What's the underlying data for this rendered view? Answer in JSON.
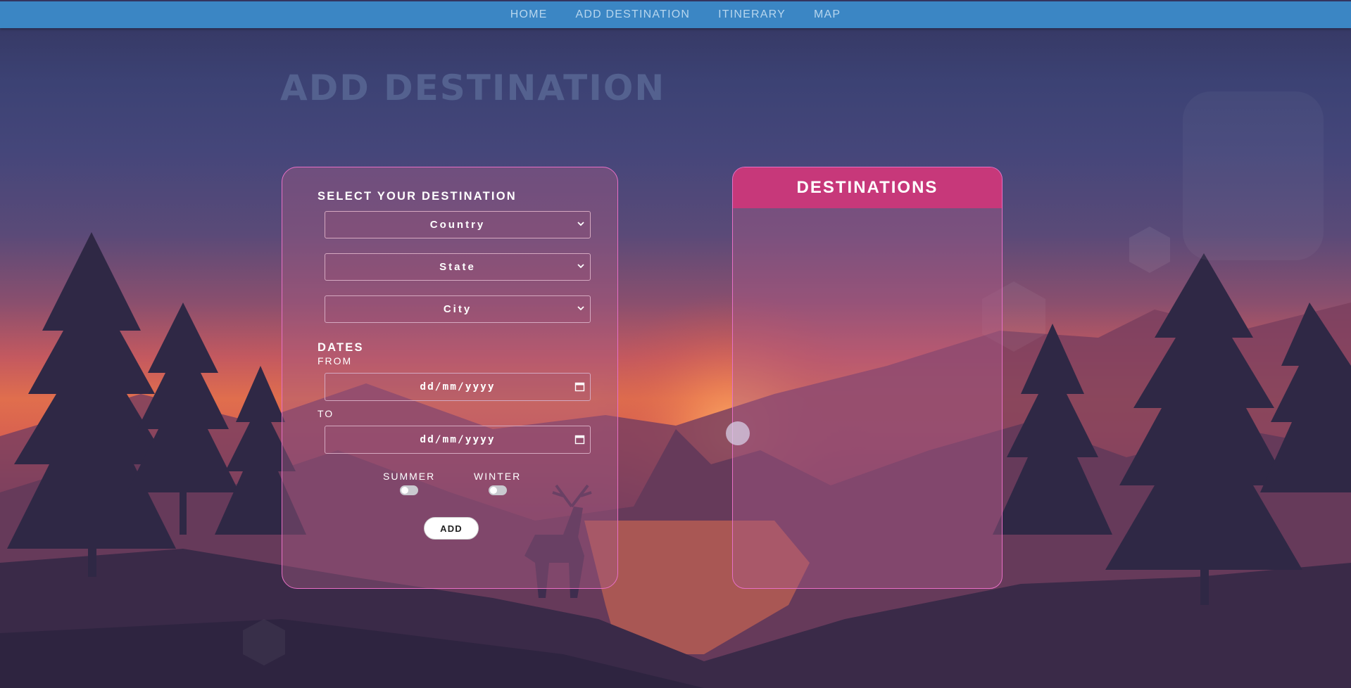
{
  "nav": {
    "items": [
      "HOME",
      "ADD DESTINATION",
      "ITINERARY",
      "MAP"
    ]
  },
  "page_title": "ADD DESTINATION",
  "form": {
    "heading": "SELECT YOUR DESTINATION",
    "country_select": {
      "value": "Country",
      "icon": "chevron-down-icon"
    },
    "state_select": {
      "value": "State",
      "icon": "chevron-down-icon"
    },
    "city_select": {
      "value": "City",
      "icon": "chevron-down-icon"
    },
    "dates_heading": "DATES",
    "from_label": "FROM",
    "from_placeholder": "dd/mm/yyyy",
    "to_label": "TO",
    "to_placeholder": "dd/mm/yyyy",
    "summer_label": "SUMMER",
    "summer_on": false,
    "winter_label": "WINTER",
    "winter_on": false,
    "add_label": "ADD"
  },
  "destinations": {
    "heading": "DESTINATIONS",
    "items": []
  },
  "colors": {
    "nav_bg": "#3b86c4",
    "card_border": "#e86fc6",
    "dest_header": "#c7387a",
    "title": "#54618f"
  }
}
